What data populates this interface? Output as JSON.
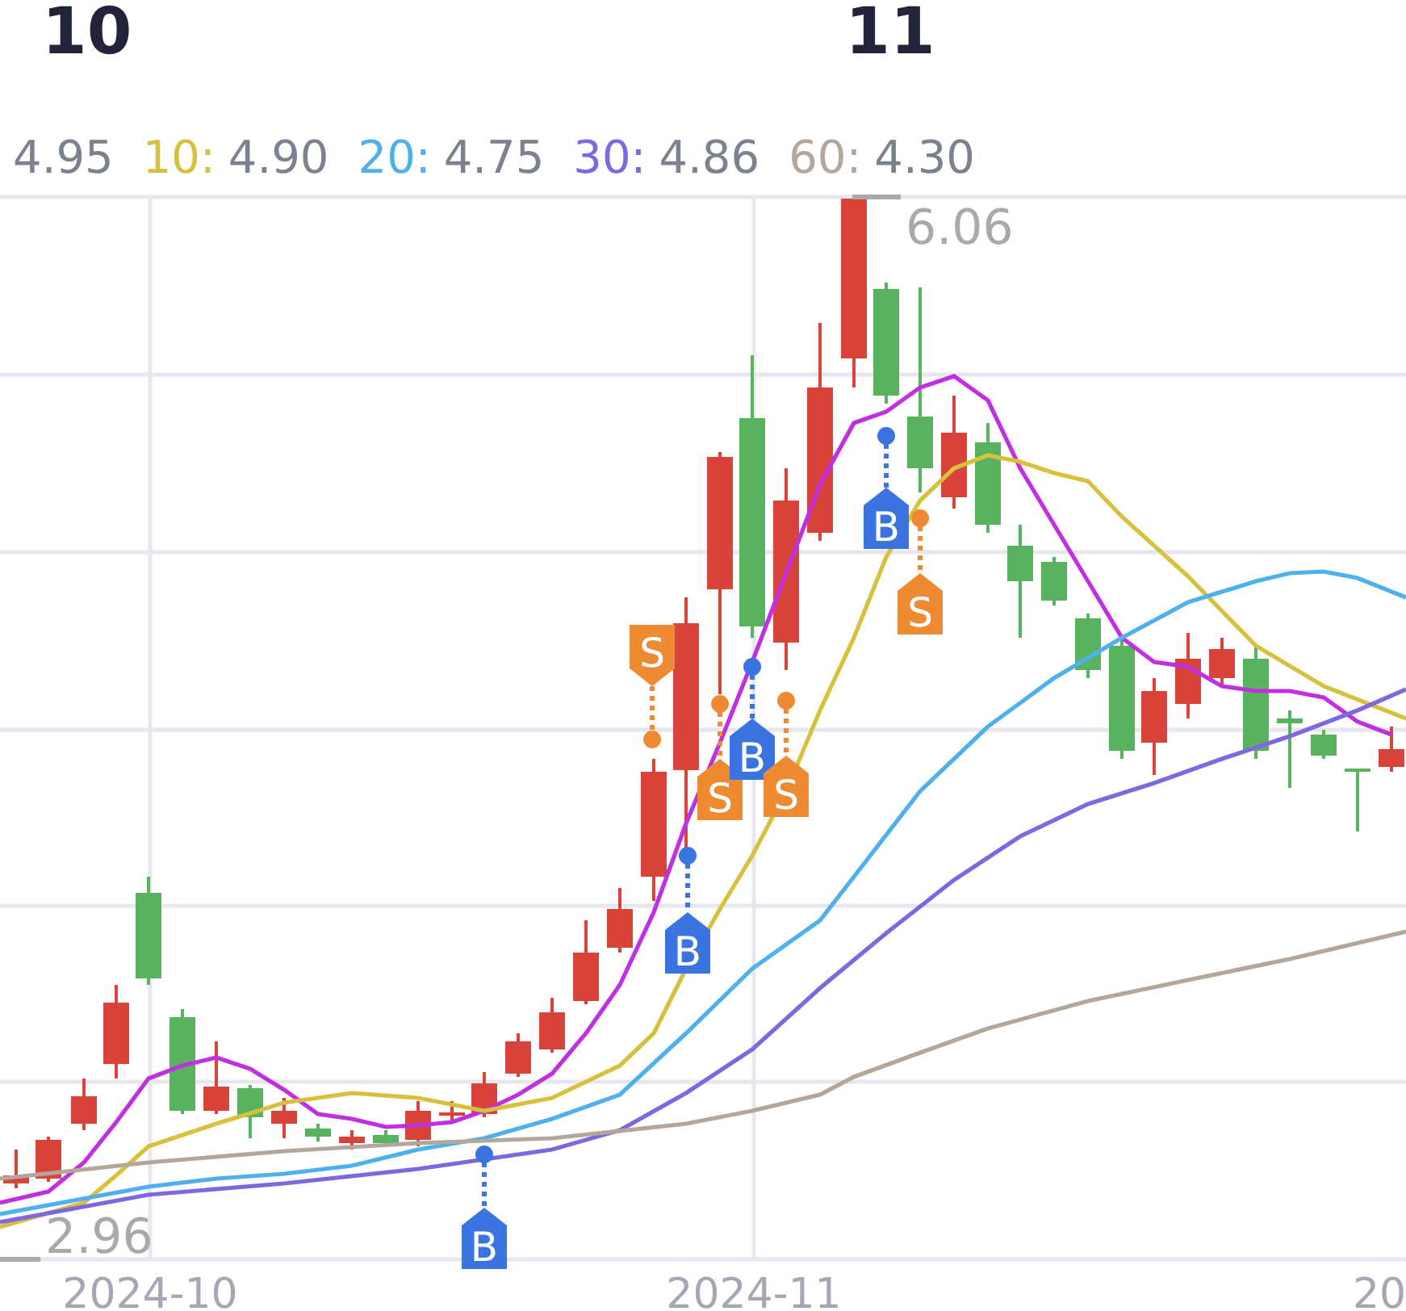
{
  "period_header": {
    "labels": [
      "10",
      "11"
    ]
  },
  "ma_legend": [
    {
      "value": "4.95"
    },
    {
      "label": "10:",
      "value": "4.90",
      "color": "#d6c03c"
    },
    {
      "label": "20:",
      "value": "4.75",
      "color": "#4fb0ee"
    },
    {
      "label": "30:",
      "value": "4.86",
      "color": "#7f67e0"
    },
    {
      "label": "60:",
      "value": "4.30",
      "color": "#b3a79c"
    }
  ],
  "chart": {
    "max_label": "6.06",
    "min_label": "2.96",
    "markers": [
      {
        "kind": "buy",
        "text": "B"
      },
      {
        "kind": "sell",
        "text": "S"
      },
      {
        "kind": "buy",
        "text": "B"
      },
      {
        "kind": "sell",
        "text": "S"
      },
      {
        "kind": "buy",
        "text": "B"
      },
      {
        "kind": "sell",
        "text": "S"
      },
      {
        "kind": "buy",
        "text": "B"
      },
      {
        "kind": "sell",
        "text": "S"
      }
    ],
    "x_labels": [
      "2024-10",
      "2024-11",
      "20"
    ]
  }
}
